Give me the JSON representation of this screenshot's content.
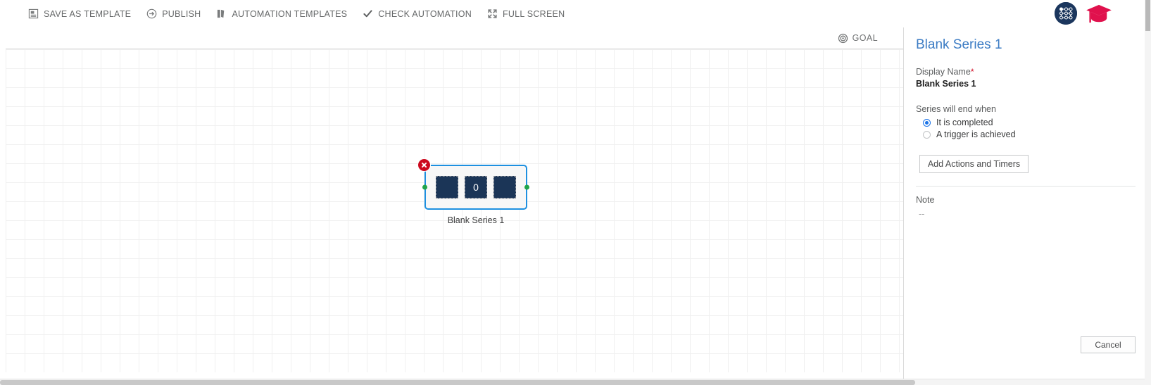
{
  "toolbar": {
    "items": [
      {
        "label": "SAVE AS TEMPLATE",
        "icon": "save-as-template-icon"
      },
      {
        "label": "PUBLISH",
        "icon": "publish-arrow-icon"
      },
      {
        "label": "AUTOMATION TEMPLATES",
        "icon": "automation-templates-icon"
      },
      {
        "label": "CHECK AUTOMATION",
        "icon": "check-automation-icon"
      },
      {
        "label": "FULL SCREEN",
        "icon": "full-screen-icon"
      }
    ],
    "right_icons": [
      {
        "name": "flow-nodes-icon",
        "color": "#1b365d"
      },
      {
        "name": "graduation-cap-icon",
        "color": "#e0114d"
      }
    ]
  },
  "canvas": {
    "goal_label": "GOAL",
    "goal_icon": "target-icon",
    "node": {
      "label": "Blank Series 1",
      "blocks": [
        "",
        "0",
        ""
      ],
      "delete_icon": "close-circle-icon",
      "left_port": "connection-port",
      "right_port": "connection-port",
      "selection_color": "#1e90e0",
      "block_color": "#1b3557",
      "port_color": "#20a44a",
      "delete_color": "#cc0a1e"
    }
  },
  "panel": {
    "title": "Blank Series 1",
    "title_color": "#3c7cc4",
    "display_name_label": "Display Name",
    "required_marker": "*",
    "display_name_value": "Blank Series 1",
    "end_when_label": "Series will end when",
    "options": [
      {
        "label": "It is completed",
        "selected": true
      },
      {
        "label": "A trigger is achieved",
        "selected": false
      }
    ],
    "add_actions_label": "Add Actions and Timers",
    "note_label": "Note",
    "note_value": "--",
    "cancel_label": "Cancel",
    "accent_color": "#1a73e8"
  }
}
